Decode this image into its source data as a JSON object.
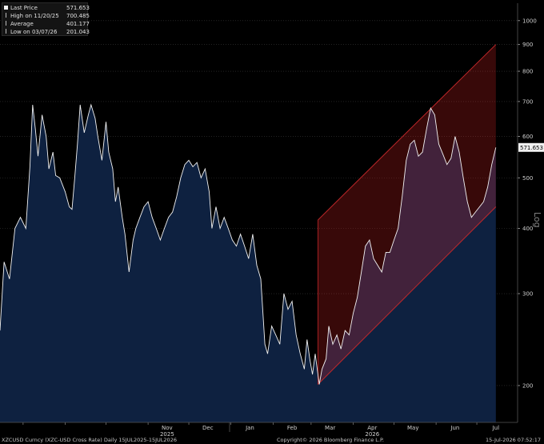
{
  "legend": [
    {
      "label": "Last Price",
      "value": "571.653",
      "marker": "square"
    },
    {
      "label": "High on 11/20/25",
      "value": "700.485",
      "marker": "tick"
    },
    {
      "label": "Average",
      "value": "401.177",
      "marker": "tick"
    },
    {
      "label": "Low on 03/07/26",
      "value": "201.043",
      "marker": "tick"
    }
  ],
  "footer": {
    "left": "XZCUSD Curncy (XZC-USD Cross Rate) Daily 15JUL2025-15JUL2026",
    "center": "Copyright© 2026 Bloomberg Finance L.P.",
    "right": "15-Jul-2026 07:52:17"
  },
  "colors": {
    "background": "#000000",
    "area_fill": "#0e2140",
    "price_line": "#f2f2f2",
    "channel_fill": "#3a0000",
    "channel_line": "#c0282a",
    "grid": "#3a3a3a"
  },
  "chart_data": {
    "type": "area",
    "yscale": "log",
    "ylabel": "Log",
    "ylim": [
      170,
      1080
    ],
    "y_ticks": [
      200,
      300,
      400,
      500,
      600,
      700,
      800,
      900,
      1000
    ],
    "x_ticks": [
      "Nov",
      "Dec",
      "Jan",
      "Feb",
      "Mar",
      "Apr",
      "May",
      "Jun",
      "Jul"
    ],
    "year_labels": [
      "2025",
      "2026"
    ],
    "last_price_label": "571.653",
    "grid": true,
    "series": [
      {
        "points": [
          [
            "2025-07-15",
            255
          ],
          [
            "2025-07-18",
            345
          ],
          [
            "2025-07-22",
            320
          ],
          [
            "2025-07-26",
            400
          ],
          [
            "2025-07-30",
            420
          ],
          [
            "2025-08-03",
            400
          ],
          [
            "2025-08-06",
            525
          ],
          [
            "2025-08-08",
            690
          ],
          [
            "2025-08-10",
            620
          ],
          [
            "2025-08-12",
            550
          ],
          [
            "2025-08-15",
            660
          ],
          [
            "2025-08-18",
            600
          ],
          [
            "2025-08-20",
            520
          ],
          [
            "2025-08-23",
            560
          ],
          [
            "2025-08-25",
            505
          ],
          [
            "2025-08-28",
            500
          ],
          [
            "2025-09-01",
            470
          ],
          [
            "2025-09-04",
            440
          ],
          [
            "2025-09-06",
            435
          ],
          [
            "2025-09-08",
            500
          ],
          [
            "2025-09-10",
            580
          ],
          [
            "2025-09-12",
            690
          ],
          [
            "2025-09-15",
            610
          ],
          [
            "2025-09-18",
            660
          ],
          [
            "2025-09-20",
            690
          ],
          [
            "2025-09-23",
            650
          ],
          [
            "2025-09-25",
            600
          ],
          [
            "2025-09-28",
            540
          ],
          [
            "2025-10-01",
            640
          ],
          [
            "2025-10-03",
            560
          ],
          [
            "2025-10-06",
            520
          ],
          [
            "2025-10-08",
            450
          ],
          [
            "2025-10-10",
            480
          ],
          [
            "2025-10-13",
            420
          ],
          [
            "2025-10-15",
            390
          ],
          [
            "2025-10-18",
            330
          ],
          [
            "2025-10-21",
            380
          ],
          [
            "2025-10-23",
            400
          ],
          [
            "2025-10-26",
            420
          ],
          [
            "2025-10-29",
            440
          ],
          [
            "2025-11-01",
            450
          ],
          [
            "2025-11-04",
            420
          ],
          [
            "2025-11-07",
            400
          ],
          [
            "2025-11-10",
            380
          ],
          [
            "2025-11-13",
            400
          ],
          [
            "2025-11-16",
            420
          ],
          [
            "2025-11-19",
            430
          ],
          [
            "2025-11-22",
            460
          ],
          [
            "2025-11-25",
            500
          ],
          [
            "2025-11-28",
            530
          ],
          [
            "2025-12-01",
            540
          ],
          [
            "2025-12-04",
            525
          ],
          [
            "2025-12-07",
            535
          ],
          [
            "2025-12-10",
            500
          ],
          [
            "2025-12-13",
            520
          ],
          [
            "2025-12-16",
            470
          ],
          [
            "2025-12-18",
            400
          ],
          [
            "2025-12-21",
            440
          ],
          [
            "2025-12-24",
            400
          ],
          [
            "2025-12-27",
            420
          ],
          [
            "2025-12-30",
            400
          ],
          [
            "2026-01-02",
            380
          ],
          [
            "2026-01-05",
            370
          ],
          [
            "2026-01-08",
            390
          ],
          [
            "2026-01-11",
            370
          ],
          [
            "2026-01-14",
            350
          ],
          [
            "2026-01-17",
            390
          ],
          [
            "2026-01-20",
            340
          ],
          [
            "2026-01-23",
            320
          ],
          [
            "2026-01-26",
            240
          ],
          [
            "2026-01-28",
            230
          ],
          [
            "2026-01-31",
            260
          ],
          [
            "2026-02-03",
            250
          ],
          [
            "2026-02-06",
            240
          ],
          [
            "2026-02-09",
            300
          ],
          [
            "2026-02-12",
            280
          ],
          [
            "2026-02-15",
            290
          ],
          [
            "2026-02-18",
            250
          ],
          [
            "2026-02-21",
            230
          ],
          [
            "2026-02-24",
            215
          ],
          [
            "2026-02-26",
            245
          ],
          [
            "2026-02-28",
            225
          ],
          [
            "2026-03-02",
            210
          ],
          [
            "2026-03-04",
            230
          ],
          [
            "2026-03-07",
            201
          ],
          [
            "2026-03-09",
            215
          ],
          [
            "2026-03-12",
            225
          ],
          [
            "2026-03-14",
            260
          ],
          [
            "2026-03-17",
            240
          ],
          [
            "2026-03-20",
            250
          ],
          [
            "2026-03-23",
            235
          ],
          [
            "2026-03-26",
            255
          ],
          [
            "2026-03-29",
            250
          ],
          [
            "2026-04-01",
            275
          ],
          [
            "2026-04-04",
            295
          ],
          [
            "2026-04-07",
            330
          ],
          [
            "2026-04-10",
            370
          ],
          [
            "2026-04-13",
            380
          ],
          [
            "2026-04-16",
            350
          ],
          [
            "2026-04-19",
            340
          ],
          [
            "2026-04-22",
            330
          ],
          [
            "2026-04-25",
            360
          ],
          [
            "2026-04-28",
            360
          ],
          [
            "2026-05-01",
            380
          ],
          [
            "2026-05-04",
            400
          ],
          [
            "2026-05-07",
            460
          ],
          [
            "2026-05-10",
            540
          ],
          [
            "2026-05-13",
            580
          ],
          [
            "2026-05-16",
            590
          ],
          [
            "2026-05-19",
            550
          ],
          [
            "2026-05-22",
            560
          ],
          [
            "2026-05-25",
            620
          ],
          [
            "2026-05-28",
            680
          ],
          [
            "2026-05-31",
            660
          ],
          [
            "2026-06-03",
            580
          ],
          [
            "2026-06-06",
            555
          ],
          [
            "2026-06-09",
            530
          ],
          [
            "2026-06-12",
            545
          ],
          [
            "2026-06-15",
            600
          ],
          [
            "2026-06-18",
            560
          ],
          [
            "2026-06-21",
            500
          ],
          [
            "2026-06-24",
            450
          ],
          [
            "2026-06-27",
            420
          ],
          [
            "2026-06-30",
            430
          ],
          [
            "2026-07-03",
            440
          ],
          [
            "2026-07-06",
            450
          ],
          [
            "2026-07-09",
            480
          ],
          [
            "2026-07-12",
            530
          ],
          [
            "2026-07-15",
            571.653
          ]
        ]
      }
    ],
    "channel": {
      "upper": [
        [
          "2026-03-06",
          415
        ],
        [
          "2026-07-15",
          900
        ]
      ],
      "lower": [
        [
          "2026-03-06",
          201
        ],
        [
          "2026-07-15",
          440
        ]
      ]
    }
  }
}
